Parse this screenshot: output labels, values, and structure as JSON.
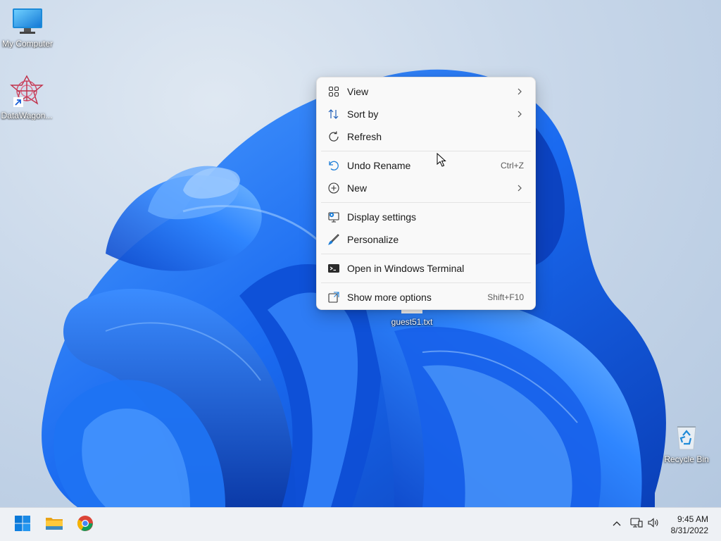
{
  "desktop": {
    "icons": [
      {
        "label": "My Computer",
        "icon": "monitor-icon"
      },
      {
        "label": "DataWagon...",
        "icon": "datawagon-icon"
      },
      {
        "label": "guest51.txt",
        "icon": "text-file-icon"
      },
      {
        "label": "Recycle Bin",
        "icon": "recycle-bin-icon"
      }
    ]
  },
  "context_menu": {
    "items": [
      {
        "label": "View",
        "icon": "view-grid-icon",
        "shortcut": "",
        "submenu": true
      },
      {
        "label": "Sort by",
        "icon": "sort-icon",
        "shortcut": "",
        "submenu": true
      },
      {
        "label": "Refresh",
        "icon": "refresh-icon",
        "shortcut": "",
        "submenu": false
      },
      {
        "label": "Undo Rename",
        "icon": "undo-icon",
        "shortcut": "Ctrl+Z",
        "submenu": false
      },
      {
        "label": "New",
        "icon": "new-plus-icon",
        "shortcut": "",
        "submenu": true
      },
      {
        "label": "Display settings",
        "icon": "display-settings-icon",
        "shortcut": "",
        "submenu": false
      },
      {
        "label": "Personalize",
        "icon": "personalize-brush-icon",
        "shortcut": "",
        "submenu": false
      },
      {
        "label": "Open in Windows Terminal",
        "icon": "terminal-icon",
        "shortcut": "",
        "submenu": false
      },
      {
        "label": "Show more options",
        "icon": "show-more-options-icon",
        "shortcut": "Shift+F10",
        "submenu": false
      }
    ]
  },
  "taskbar": {
    "apps": [
      {
        "name": "Start",
        "icon": "windows-start-icon"
      },
      {
        "name": "File Explorer",
        "icon": "folder-icon"
      },
      {
        "name": "Google Chrome",
        "icon": "chrome-icon"
      }
    ],
    "tray": {
      "icons": [
        "chevron-up-icon",
        "network-icon",
        "volume-icon"
      ],
      "time": "9:45 AM",
      "date": "8/31/2022"
    }
  },
  "colors": {
    "accent": "#0067c0",
    "wallpaper_blue": "#1565e8",
    "menu_bg": "#f9f9f9"
  }
}
